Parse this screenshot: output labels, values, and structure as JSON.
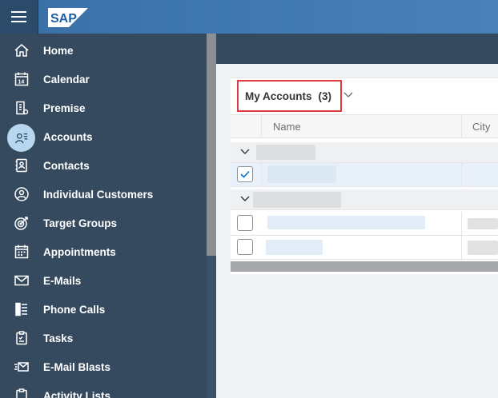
{
  "header": {
    "menu_icon": "hamburger-icon",
    "logo_text": "SAP",
    "brand_color": "#3f77b0"
  },
  "sidebar": {
    "items": [
      {
        "label": "Home",
        "icon": "home-icon"
      },
      {
        "label": "Calendar",
        "icon": "calendar-icon"
      },
      {
        "label": "Premise",
        "icon": "building-icon"
      },
      {
        "label": "Accounts",
        "icon": "accounts-icon",
        "active": true
      },
      {
        "label": "Contacts",
        "icon": "contacts-icon"
      },
      {
        "label": "Individual Customers",
        "icon": "person-circle-icon"
      },
      {
        "label": "Target Groups",
        "icon": "target-icon"
      },
      {
        "label": "Appointments",
        "icon": "appointment-icon"
      },
      {
        "label": "E-Mails",
        "icon": "envelope-icon"
      },
      {
        "label": "Phone Calls",
        "icon": "phone-list-icon"
      },
      {
        "label": "Tasks",
        "icon": "clipboard-icon"
      },
      {
        "label": "E-Mail Blasts",
        "icon": "email-blast-icon"
      },
      {
        "label": "Activity Lists",
        "icon": "activity-list-icon"
      }
    ]
  },
  "view": {
    "title": "My Accounts",
    "count": "(3)"
  },
  "table": {
    "columns": [
      "Name",
      "City"
    ]
  }
}
